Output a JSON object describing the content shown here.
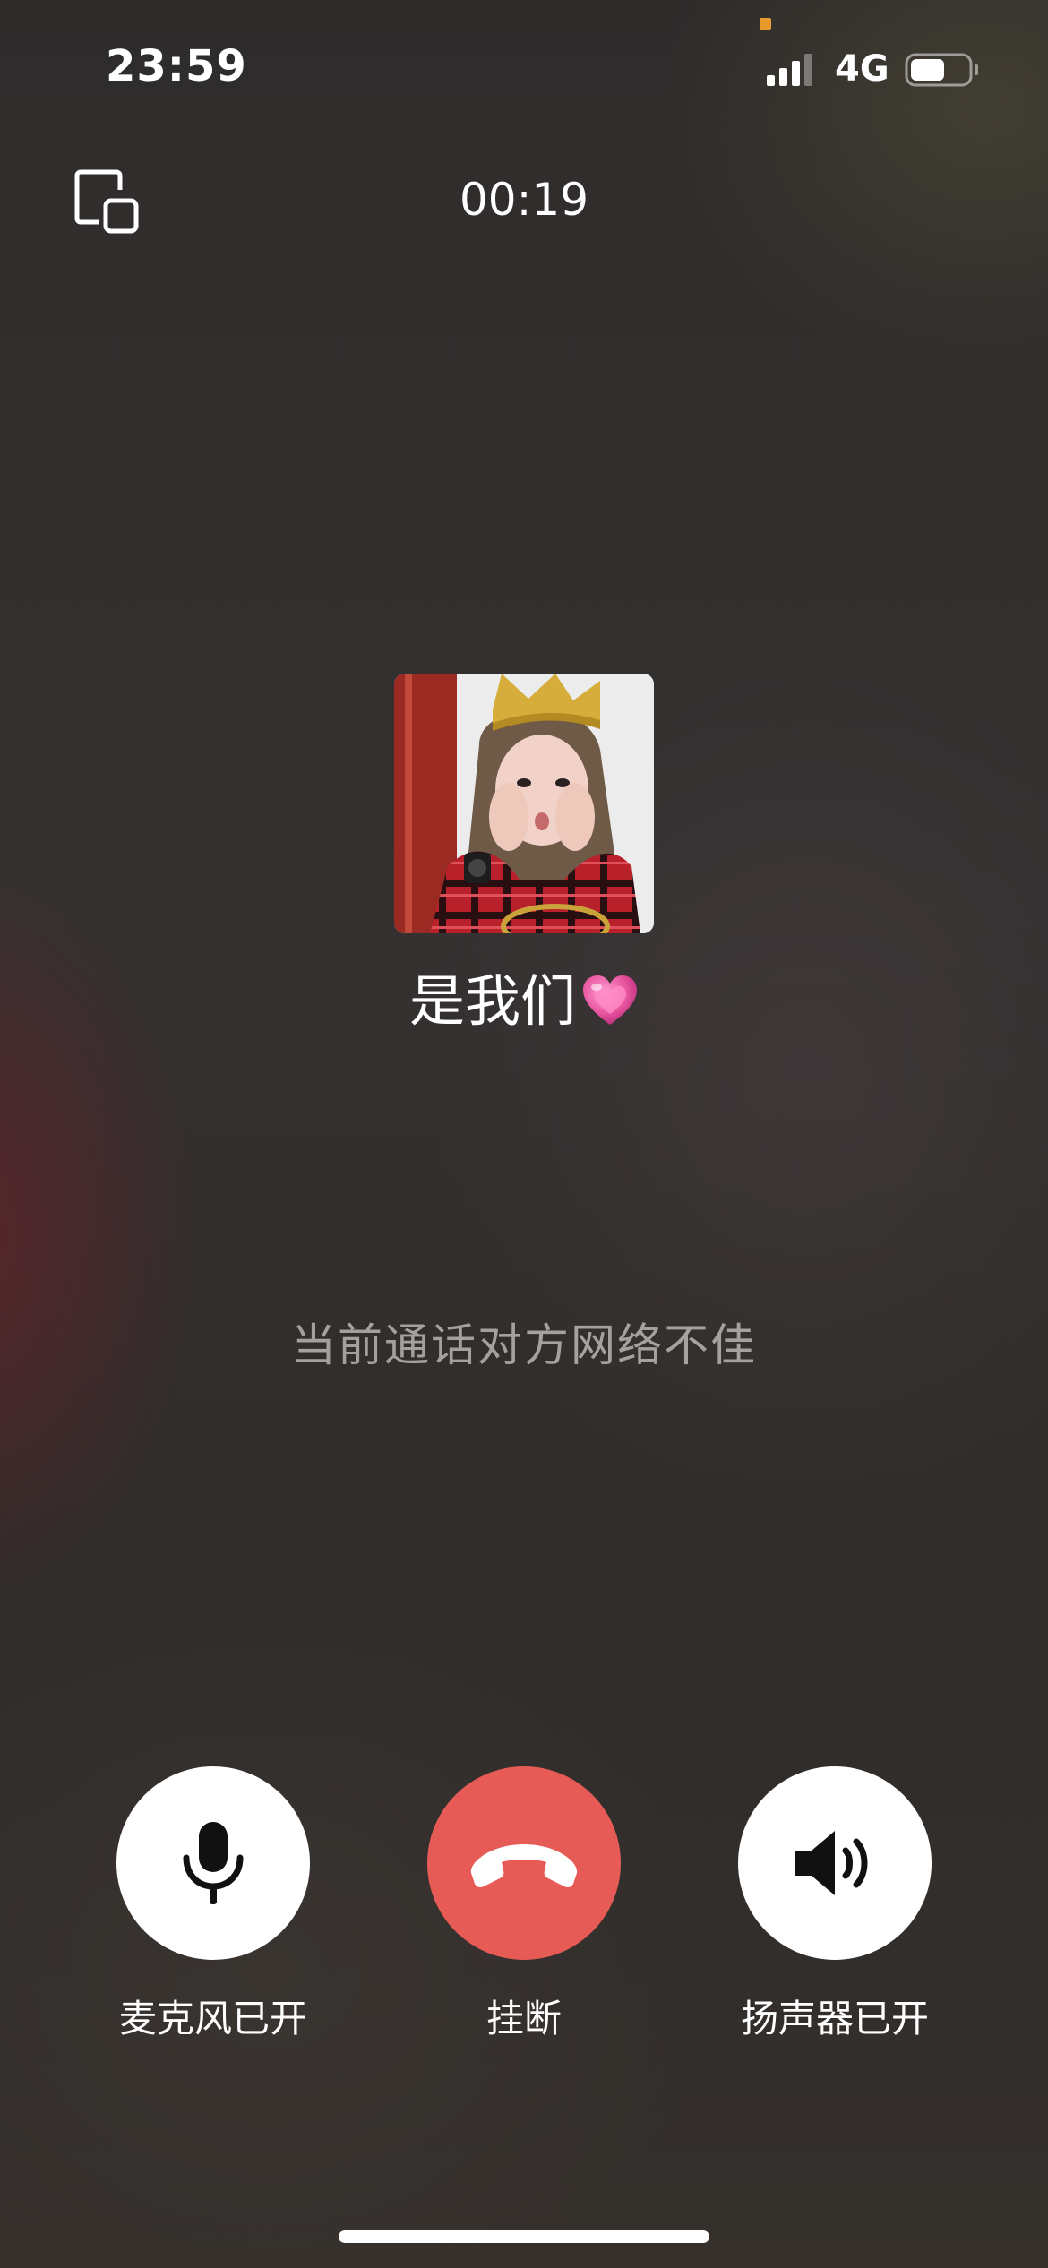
{
  "status_bar": {
    "time": "23:59",
    "network": "4G",
    "battery_level": 0.6,
    "signal_bars": 3
  },
  "call": {
    "timer": "00:19",
    "contact_name": "是我们",
    "name_emoji_icon": "pink-heart-icon",
    "network_warning": "当前通话对方网络不佳"
  },
  "controls": {
    "mic_label": "麦克风已开",
    "hangup_label": "挂断",
    "speaker_label": "扬声器已开"
  },
  "colors": {
    "hangup": "#e65b56",
    "control_bg": "#ffffff",
    "privacy_dot": "#e89a2c"
  }
}
